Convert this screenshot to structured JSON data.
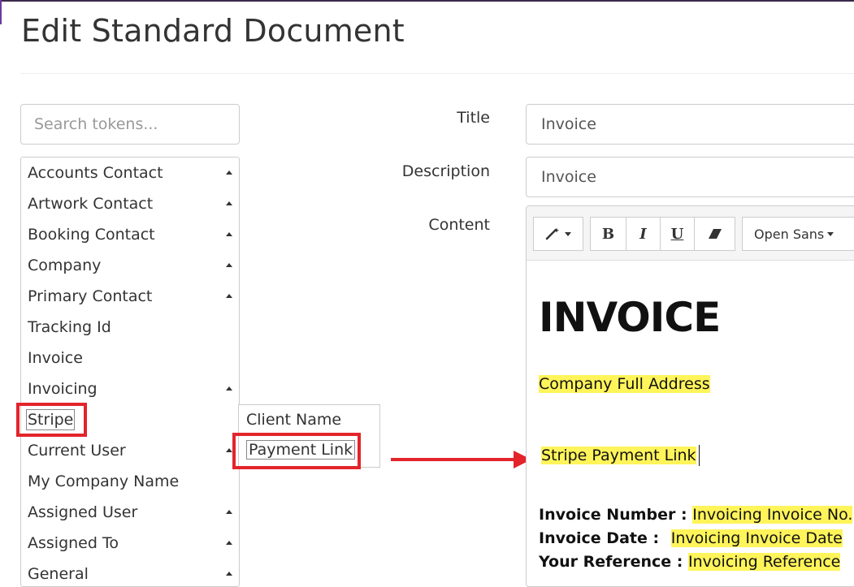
{
  "page": {
    "title": "Edit Standard Document"
  },
  "search": {
    "placeholder": "Search tokens..."
  },
  "token_groups": [
    {
      "label": "Accounts Contact",
      "expandable": true
    },
    {
      "label": "Artwork Contact",
      "expandable": true
    },
    {
      "label": "Booking Contact",
      "expandable": true
    },
    {
      "label": "Company",
      "expandable": true
    },
    {
      "label": "Primary Contact",
      "expandable": true
    },
    {
      "label": "Tracking Id",
      "expandable": false
    },
    {
      "label": "Invoice",
      "expandable": false
    },
    {
      "label": "Invoicing",
      "expandable": true
    },
    {
      "label": "Stripe",
      "expandable": false
    },
    {
      "label": "Current User",
      "expandable": true
    },
    {
      "label": "My Company Name",
      "expandable": false
    },
    {
      "label": "Assigned User",
      "expandable": true
    },
    {
      "label": "Assigned To",
      "expandable": true
    },
    {
      "label": "General",
      "expandable": true
    }
  ],
  "stripe_submenu": {
    "items": [
      {
        "label": "Client Name"
      },
      {
        "label": "Payment Link"
      }
    ]
  },
  "form": {
    "title_label": "Title",
    "title_value": "Invoice",
    "description_label": "Description",
    "description_value": "Invoice",
    "content_label": "Content"
  },
  "toolbar": {
    "style_icon": "magic-wand-icon",
    "bold": "B",
    "italic": "I",
    "underline": "U",
    "eraser_icon": "eraser-icon",
    "font_name": "Open Sans"
  },
  "document": {
    "heading": "INVOICE",
    "address_token": "Company Full Address",
    "payment_token": "Stripe Payment Link",
    "fields": [
      {
        "label": "Invoice Number :",
        "value": "Invoicing Invoice No."
      },
      {
        "label": "Invoice Date :",
        "value": "Invoicing Invoice Date"
      },
      {
        "label": "Your Reference :",
        "value": "Invoicing Reference"
      }
    ]
  },
  "colors": {
    "highlight": "#fff45a",
    "annotation_red": "#e3242b",
    "border": "#cccccc"
  }
}
